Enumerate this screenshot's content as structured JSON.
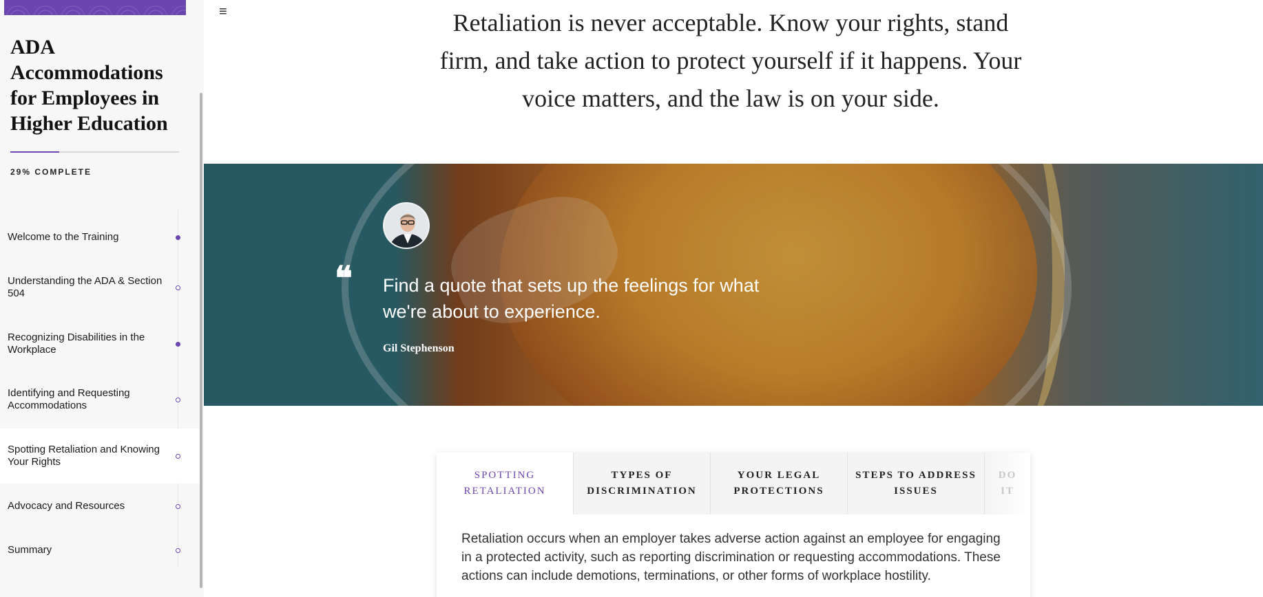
{
  "sidebar": {
    "course_title": "ADA Accommodations for Employees in Higher Education",
    "progress_percent": 29,
    "progress_label": "29% COMPLETE",
    "items": [
      {
        "label": "Welcome to the Training",
        "status": "done"
      },
      {
        "label": "Understanding the ADA & Section 504",
        "status": "todo"
      },
      {
        "label": "Recognizing Disabilities in the Workplace",
        "status": "done"
      },
      {
        "label": "Identifying and Requesting Accommodations",
        "status": "todo"
      },
      {
        "label": "Spotting Retaliation and Knowing Your Rights",
        "status": "todo"
      },
      {
        "label": "Advocacy and Resources",
        "status": "todo"
      },
      {
        "label": "Summary",
        "status": "todo"
      }
    ],
    "active_index": 4
  },
  "main": {
    "menu_icon": "≡",
    "intro_text": "Retaliation is never acceptable. Know your rights, stand firm, and take action to protect yourself if it happens. Your voice matters, and the law is on your side.",
    "quote": {
      "mark": "❝",
      "text": "Find a quote that sets up the feelings for what we're about to experience.",
      "author": "Gil Stephenson"
    },
    "tabs": [
      {
        "label": "SPOTTING RETALIATION"
      },
      {
        "label": "TYPES OF DISCRIMINATION"
      },
      {
        "label": "YOUR LEGAL PROTECTIONS"
      },
      {
        "label": "STEPS TO ADDRESS ISSUES"
      },
      {
        "label": "DO IT"
      }
    ],
    "tab_content": "Retaliation occurs when an employer takes adverse action against an employee for engaging in a protected activity, such as reporting discrimination or requesting accommodations. These actions can include demotions, terminations, or other forms of workplace hostility."
  },
  "colors": {
    "accent": "#6b45b0",
    "sidebar_bg": "#f7f7f7"
  }
}
